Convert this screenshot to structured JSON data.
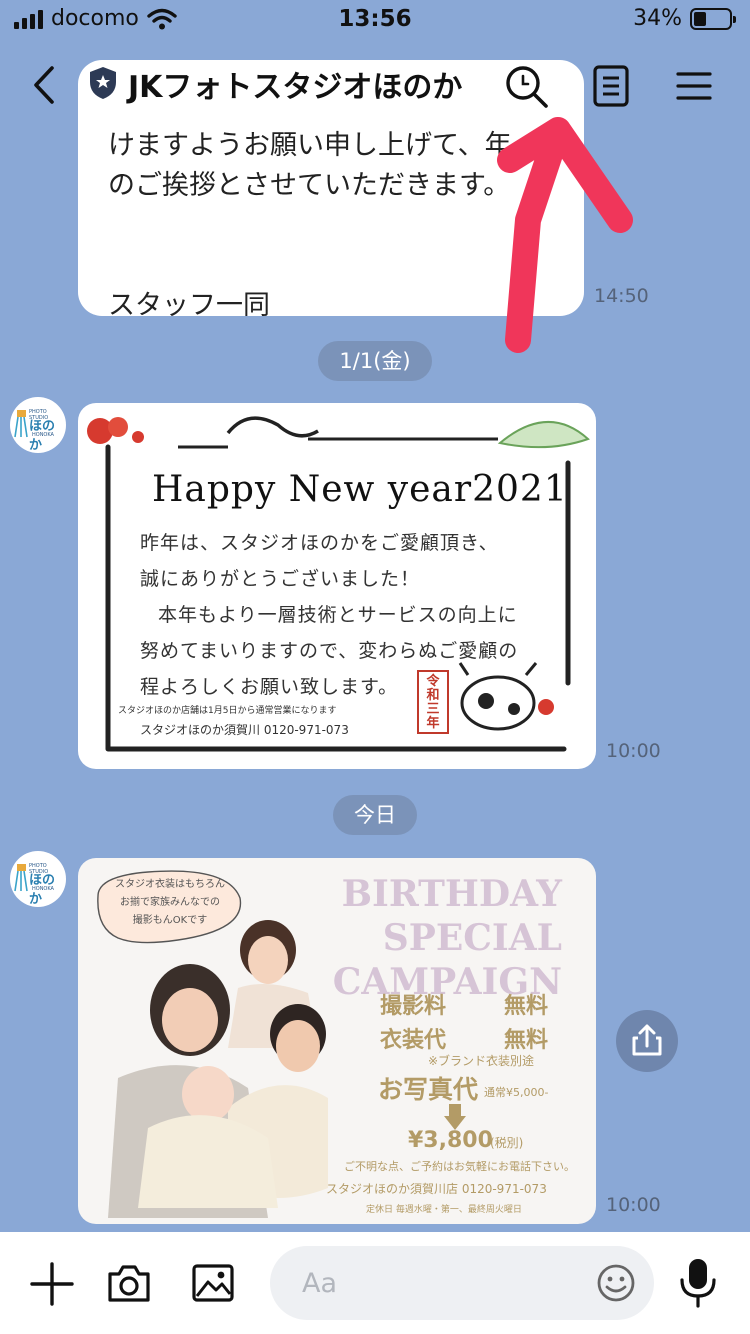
{
  "status_bar": {
    "carrier": "docomo",
    "time": "13:56",
    "battery": "34%",
    "battery_level": 0.34,
    "icons": [
      "signal-icon",
      "wifi-icon",
      "battery-icon"
    ]
  },
  "header": {
    "title": "JKフォトスタジオほのか",
    "icons": [
      "back-icon",
      "official-shield-icon",
      "search-icon",
      "notes-icon",
      "menu-icon"
    ]
  },
  "messages": [
    {
      "type": "text",
      "text": "けますようお願い申し上げて、年\nのご挨拶とさせていただきます。\n\n\nスタッフ一同",
      "time": "14:50"
    },
    {
      "type": "date",
      "label": "1/1(金)"
    },
    {
      "type": "image",
      "avatar": {
        "top_label": "PHOTO STUDIO",
        "name": "ほのか",
        "sub": "HONOKA"
      },
      "card": {
        "heading": "Happy New year2021",
        "lines": [
          "昨年は、スタジオほのかをご愛顧頂き、",
          "誠にありがとうございました！",
          "本年もより一層技術とサービスの向上に",
          "努めてまいりますので、変わらぬご愛顧の",
          "程よろしくお願い致します。"
        ],
        "footer1": "スタジオほのか店舗は1月5日から通常営業になります",
        "footer2": "スタジオほのか須賀川 0120-971-073",
        "seal": "令和三年"
      },
      "time": "10:00"
    },
    {
      "type": "date",
      "label": "今日"
    },
    {
      "type": "image",
      "avatar": {
        "top_label": "PHOTO STUDIO",
        "name": "ほのか",
        "sub": "HONOKA"
      },
      "card": {
        "speech": [
          "スタジオ衣装はもちろん",
          "お揃で家族みんなでの",
          "撮影もんOKです"
        ],
        "title": [
          "BIRTHDAY",
          "SPECIAL",
          "CAMPAIGN"
        ],
        "row1_left": "撮影料",
        "row1_right": "無料",
        "row2_left": "衣装代",
        "row2_right": "無料",
        "note": "※ブランド衣装別途",
        "price_label": "お写真代",
        "price_regular": "通常¥5,000-",
        "price": "¥3,800",
        "price_tax": "(税別)",
        "contact1": "ご不明な点、ご予約はお気軽にお電話下さい。",
        "contact2": "スタジオほのか須賀川店 0120-971-073",
        "contact3": "定休日 毎週水曜・第一、最終周火曜日"
      },
      "time": "10:00"
    }
  ],
  "input": {
    "placeholder": "Aa",
    "icons": [
      "plus-icon",
      "camera-icon",
      "image-icon",
      "emoji-icon",
      "microphone-icon"
    ]
  },
  "colors": {
    "background": "#8aa8d6",
    "date_pill": "#7b93b9",
    "annotation_arrow": "#f0365a",
    "campaign_title": "#d6c4d6",
    "campaign_gold": "#b39b66"
  }
}
